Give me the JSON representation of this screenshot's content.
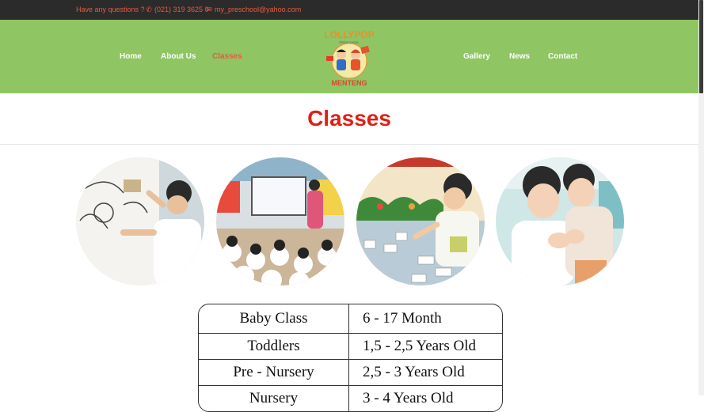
{
  "topbar": {
    "question": "Have any questions ?",
    "phone": "(021) 319 3625 0",
    "email": "my_preschool@yahoo.com",
    "phone_icon": "phone-icon",
    "email_icon": "envelope-icon"
  },
  "nav": {
    "home": "Home",
    "about": "About Us",
    "classes": "Classes",
    "gallery": "Gallery",
    "news": "News",
    "contact": "Contact"
  },
  "logo": {
    "top_text": "LOLLYPOP",
    "bottom_text": "MENTENG",
    "small_text": "PRESCHOOL"
  },
  "page": {
    "title": "Classes"
  },
  "colors": {
    "accent": "#e85a44",
    "header_bg": "#8fc563",
    "title_red": "#e01f16",
    "topbar_bg": "#2b2b2b"
  },
  "classes_table": [
    {
      "name": "Baby Class",
      "age": "6 - 17 Month"
    },
    {
      "name": "Toddlers",
      "age": "1,5 - 2,5 Years Old"
    },
    {
      "name": "Pre - Nursery",
      "age": "2,5 - 3 Years Old"
    },
    {
      "name": "Nursery",
      "age": "3 - 4 Years Old"
    }
  ]
}
